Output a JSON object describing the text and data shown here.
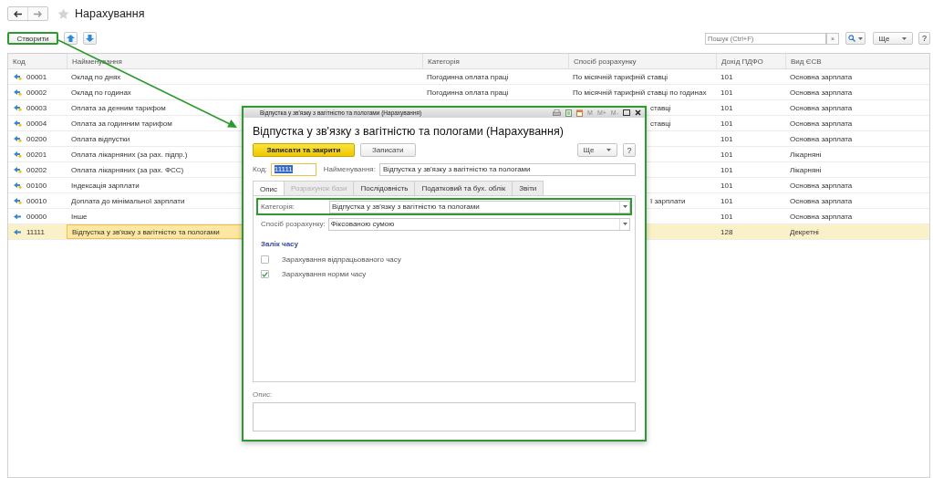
{
  "nav": {
    "title": "Нарахування"
  },
  "toolbar": {
    "create": {
      "label": "Створити",
      "highlighted": true
    },
    "search": {
      "placeholder": "Пошук (Ctrl+F)"
    },
    "clear": "×",
    "more": "Ще",
    "help": "?"
  },
  "table": {
    "columns": [
      "Код",
      "Найменування",
      "Категорія",
      "Спосіб розрахунку",
      "Дохід ПДФО",
      "Вид ЄСВ"
    ],
    "rows": [
      {
        "predefined": true,
        "code": "00001",
        "name": "Оклад по днях",
        "category": "Погодинна оплата праці",
        "method": "По місячній тарифній ставці",
        "method_cut": false,
        "pdfo": "101",
        "esv": "Основна зарплата",
        "selected": false
      },
      {
        "predefined": true,
        "code": "00002",
        "name": "Оклад по годинах",
        "category": "Погодинна оплата праці",
        "method": "По місячній тарифній ставці по годинах",
        "method_cut": false,
        "pdfo": "101",
        "esv": "Основна зарплата",
        "selected": false
      },
      {
        "predefined": true,
        "code": "00003",
        "name": "Оплата за денним тарифом",
        "method": "ставці",
        "method_cut": true,
        "pdfo": "101",
        "esv": "Основна зарплата",
        "selected": false
      },
      {
        "predefined": true,
        "code": "00004",
        "name": "Оплата за годинним тарифом",
        "method": "ставці",
        "method_cut": true,
        "pdfo": "101",
        "esv": "Основна зарплата",
        "selected": false
      },
      {
        "predefined": true,
        "code": "00200",
        "name": "Оплата відпустки",
        "pdfo": "101",
        "esv": "Основна зарплата",
        "selected": false
      },
      {
        "predefined": true,
        "code": "00201",
        "name": "Оплата лікарняних (за рах. підпр.)",
        "pdfo": "101",
        "esv": "Лікарняні",
        "selected": false
      },
      {
        "predefined": true,
        "code": "00202",
        "name": "Оплата лікарняних (за рах. ФСС)",
        "pdfo": "101",
        "esv": "Лікарняні",
        "selected": false
      },
      {
        "predefined": true,
        "code": "00100",
        "name": "Індексація зарплати",
        "pdfo": "101",
        "esv": "Основна зарплата",
        "selected": false
      },
      {
        "predefined": true,
        "code": "00010",
        "name": "Доплата до мінімальної зарплати",
        "method": "ї зарплати",
        "method_cut": true,
        "pdfo": "101",
        "esv": "Основна зарплата",
        "selected": false
      },
      {
        "predefined": false,
        "code": "00000",
        "name": "Інше",
        "pdfo": "101",
        "esv": "Основна зарплата",
        "selected": false
      },
      {
        "predefined": false,
        "code": "11111",
        "name": "Відпустка у зв'язку з вагітністю та пологами",
        "pdfo": "128",
        "esv": "Декретні",
        "selected": true
      }
    ]
  },
  "dialog": {
    "window_title": "Відпустка у зв'язку з вагітністю та пологами (Нарахування)",
    "memory_keys": [
      "M",
      "M+",
      "M-"
    ],
    "heading": "Відпустка у зв'язку з вагітністю та пологами (Нарахування)",
    "buttons": [
      {
        "label": "Записати та закрити",
        "kind": "primary"
      },
      {
        "label": "Записати",
        "kind": "normal"
      }
    ],
    "more": "Ще",
    "help": "?",
    "code": {
      "label": "Код:",
      "value": "11111",
      "highlighted": true
    },
    "name": {
      "label": "Найменування:",
      "value": "Відпустка у зв'язку з вагітністю та пологами"
    },
    "tabs": [
      {
        "label": "Опис",
        "selected": true,
        "disabled": false
      },
      {
        "label": "Розрахунок бази",
        "selected": false,
        "disabled": true
      },
      {
        "label": "Послідовність",
        "selected": false,
        "disabled": false
      },
      {
        "label": "Податковий та бух. облік",
        "selected": false,
        "disabled": false
      },
      {
        "label": "Звіти",
        "selected": false,
        "disabled": false
      }
    ],
    "fields": [
      {
        "label": "Категорія:",
        "value": "Відпустка у зв'язку з вагітністю та пологами",
        "highlighted": true
      },
      {
        "label": "Спосіб розрахунку:",
        "value": "Фіксованою сумою",
        "highlighted": false
      }
    ],
    "section": "Залік часу",
    "checkboxes": [
      {
        "label": "Зарахування відпрацьованого часу",
        "checked": false
      },
      {
        "label": "Зарахування норми часу",
        "checked": true
      }
    ],
    "description": {
      "label": "Опис:"
    }
  }
}
